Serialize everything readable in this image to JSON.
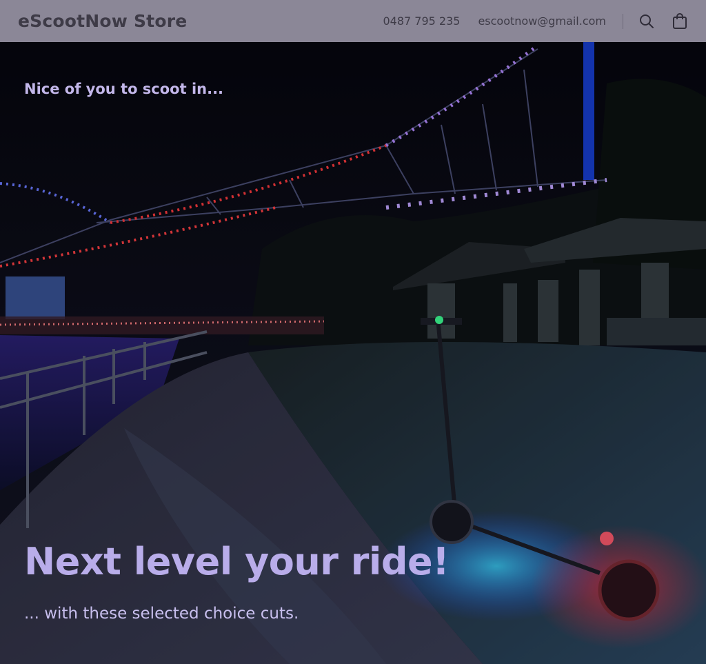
{
  "header": {
    "brand": "eScootNow Store",
    "phone": "0487 795 235",
    "email": "escootnow@gmail.com",
    "icons": [
      "search-icon",
      "shopping-bag-icon"
    ]
  },
  "hero": {
    "eyebrow": "Nice of you to scoot in...",
    "headline": "Next level your ride!",
    "subline": "... with these selected choice cuts."
  },
  "colors": {
    "header_bg": "#8b8797",
    "header_text": "#3e3b47",
    "accent_text": "#b9adea"
  }
}
